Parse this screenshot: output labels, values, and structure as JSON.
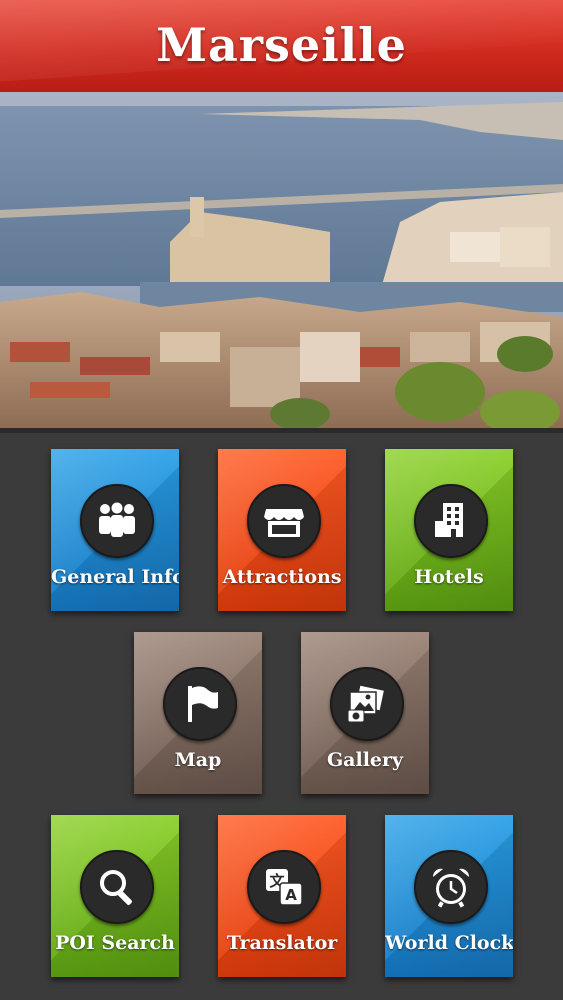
{
  "header": {
    "title": "Marseille"
  },
  "tiles": [
    {
      "label": "General Info",
      "icon": "people-icon",
      "color": "#1f8ad6"
    },
    {
      "label": "Attractions",
      "icon": "storefront-icon",
      "color": "#f04a18"
    },
    {
      "label": "Hotels",
      "icon": "building-icon",
      "color": "#76bd1e"
    },
    {
      "label": "Map",
      "icon": "flag-icon",
      "color": "#84706a"
    },
    {
      "label": "Gallery",
      "icon": "photos-icon",
      "color": "#84706a"
    },
    {
      "label": "POI Search",
      "icon": "magnifier-icon",
      "color": "#76bd1e"
    },
    {
      "label": "Translator",
      "icon": "translate-icon",
      "color": "#f04a18"
    },
    {
      "label": "World Clock",
      "icon": "alarm-clock-icon",
      "color": "#1f8ad6"
    }
  ]
}
